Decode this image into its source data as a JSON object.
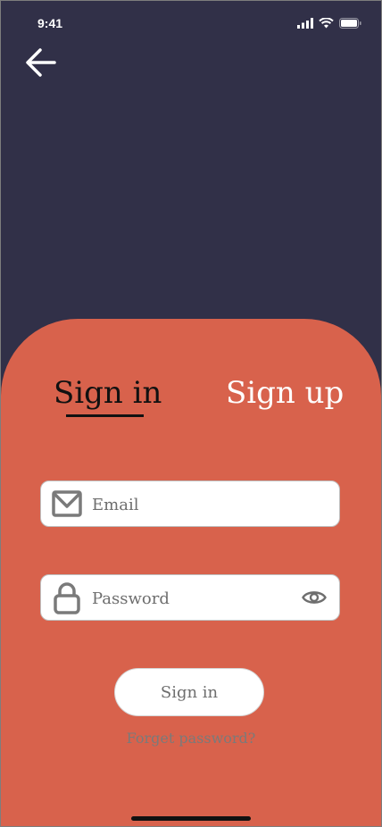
{
  "status_bar": {
    "time": "9:41",
    "icons": [
      "signal-icon",
      "wifi-icon",
      "battery-icon"
    ]
  },
  "nav": {
    "back_icon": "arrow-left-icon"
  },
  "tabs": [
    {
      "label": "Sign in",
      "active": true
    },
    {
      "label": "Sign up",
      "active": false
    }
  ],
  "form": {
    "email": {
      "placeholder": "Email",
      "value": "",
      "icon": "mail-icon"
    },
    "password": {
      "placeholder": "Password",
      "value": "",
      "icon": "lock-icon",
      "toggle_icon": "eye-icon"
    },
    "submit_label": "Sign in",
    "forgot_label": "Forget password?"
  },
  "colors": {
    "background": "#313048",
    "sheet": "#d8624c",
    "field": "#ffffff",
    "active_tab": "#111111",
    "inactive_tab": "#ffffff"
  }
}
